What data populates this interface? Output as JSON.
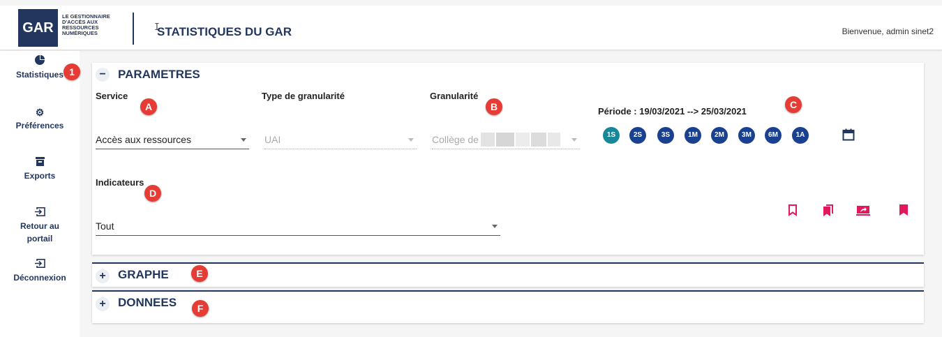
{
  "header": {
    "logo_short": "GAR",
    "logo_text": "LE GESTIONNAIRE D'ACCÈS AUX RESSOURCES NUMÉRIQUES",
    "title": "STATISTIQUES DU GAR",
    "welcome": "Bienvenue, admin sinet2"
  },
  "sidebar": {
    "items": [
      {
        "label": "Statistiques",
        "icon": "pie-chart-icon"
      },
      {
        "label": "Préférences",
        "icon": "gear-icon"
      },
      {
        "label": "Exports",
        "icon": "archive-icon"
      },
      {
        "label": "Retour au portail",
        "icon": "login-icon"
      },
      {
        "label": "Déconnexion",
        "icon": "logout-icon"
      }
    ]
  },
  "params": {
    "title": "PARAMETRES",
    "toggle": "−",
    "service_label": "Service",
    "service_value": "Accès aux ressources",
    "type_gran_label": "Type de granularité",
    "type_gran_value": "UAI",
    "granularite_label": "Granularité",
    "granularite_value": "Collège de",
    "periode": "Période : 19/03/2021 --> 25/03/2021",
    "period_chips": [
      "1S",
      "2S",
      "3S",
      "1M",
      "2M",
      "3M",
      "6M",
      "1A"
    ],
    "active_chip": "1S",
    "indicateurs_label": "Indicateurs",
    "indicateurs_value": "Tout"
  },
  "graphe": {
    "title": "GRAPHE",
    "toggle": "+"
  },
  "donnees": {
    "title": "DONNEES",
    "toggle": "+"
  },
  "markers": [
    "1",
    "A",
    "B",
    "C",
    "D",
    "E",
    "F"
  ],
  "colors": {
    "primary": "#23375e",
    "chip": "#1a4190",
    "chip_active": "#16889a",
    "action": "#e2185b",
    "marker": "#e63c35"
  }
}
